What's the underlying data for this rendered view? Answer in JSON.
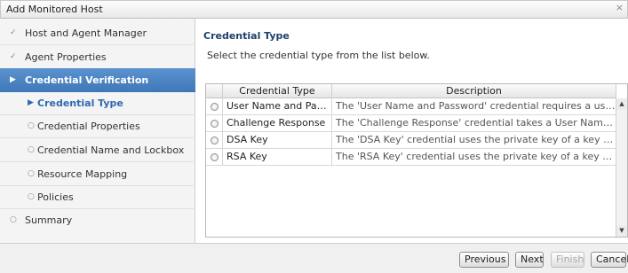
{
  "window": {
    "title": "Add Monitored Host",
    "close_glyph": "×"
  },
  "sidebar": {
    "items": [
      {
        "label": "Host and Agent Manager",
        "marker": "✓",
        "level": 0,
        "state": "done"
      },
      {
        "label": "Agent Properties",
        "marker": "✓",
        "level": 0,
        "state": "done"
      },
      {
        "label": "Credential Verification",
        "marker": "▶",
        "level": 0,
        "state": "selected"
      },
      {
        "label": "Credential Type",
        "marker": "▶",
        "level": 1,
        "state": "current"
      },
      {
        "label": "Credential Properties",
        "marker": "○",
        "level": 1,
        "state": "pending"
      },
      {
        "label": "Credential Name and Lockbox",
        "marker": "○",
        "level": 1,
        "state": "pending"
      },
      {
        "label": "Resource Mapping",
        "marker": "○",
        "level": 1,
        "state": "pending"
      },
      {
        "label": "Policies",
        "marker": "○",
        "level": 1,
        "state": "pending"
      },
      {
        "label": "Summary",
        "marker": "○",
        "level": 0,
        "state": "pending"
      }
    ]
  },
  "main": {
    "section_title": "Credential Type",
    "instructions": "Select the credential type from the list below.",
    "table": {
      "columns": [
        "Credential Type",
        "Description"
      ],
      "rows": [
        {
          "type": "User Name and Password",
          "description": "The 'User Name and Password' credential requires a user name and a p...",
          "selected": false
        },
        {
          "type": "Challenge Response",
          "description": "The 'Challenge Response' credential takes a User Name and a series of...",
          "selected": false
        },
        {
          "type": "DSA Key",
          "description": "The 'DSA Key' credential uses the private key of a key pair generated ...",
          "selected": false
        },
        {
          "type": "RSA Key",
          "description": "The 'RSA Key' credential uses the private key of a key pair generated ...",
          "selected": false
        }
      ]
    }
  },
  "scrollbar": {
    "up_glyph": "▲",
    "down_glyph": "▼"
  },
  "footer": {
    "buttons": [
      {
        "label": "Previous",
        "enabled": true
      },
      {
        "label": "Next",
        "enabled": true
      },
      {
        "label": "Finish",
        "enabled": false
      },
      {
        "label": "Cancel",
        "enabled": true
      }
    ]
  },
  "colors": {
    "selected_nav_bg": "#4a84c4",
    "current_nav_text": "#2f69b1",
    "section_title": "#1d3f6b"
  }
}
